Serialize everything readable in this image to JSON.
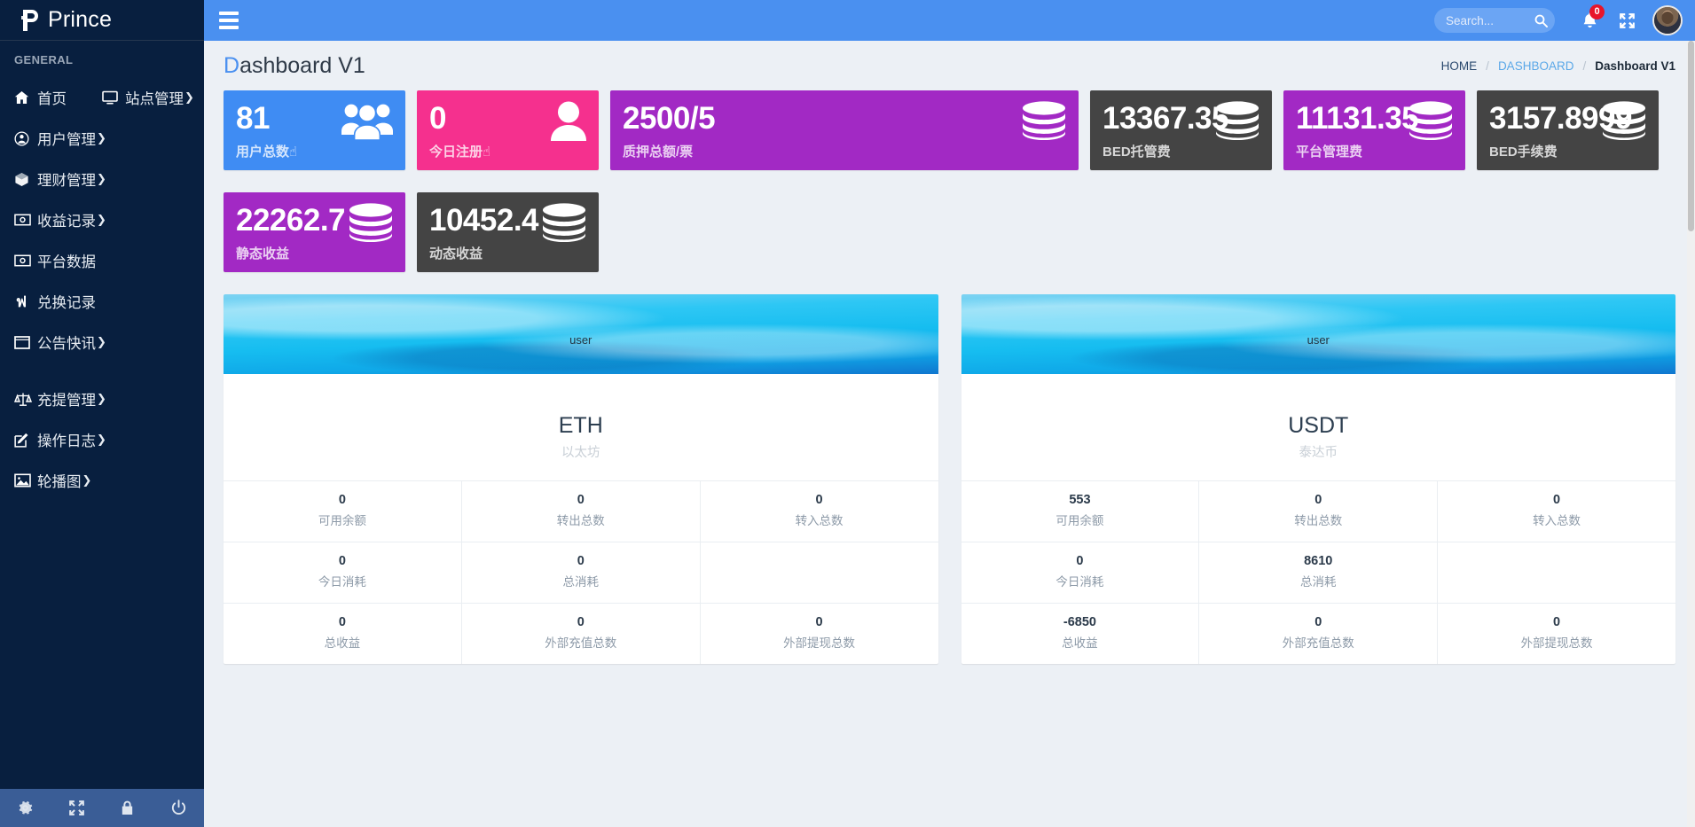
{
  "brand": {
    "name": "Prince",
    "logo_icon": "prince-p-logo"
  },
  "sidebar": {
    "section_header": "GENERAL",
    "items": [
      {
        "label": "首页",
        "icon": "home-icon",
        "caret": "",
        "active": true
      },
      {
        "label": "站点管理",
        "icon": "monitor-icon",
        "caret": "❯",
        "active": false
      },
      {
        "label": "用户管理",
        "icon": "user-circle-icon",
        "caret": "❯",
        "active": false
      },
      {
        "label": "理财管理",
        "icon": "cube-icon",
        "caret": "❯",
        "active": false
      },
      {
        "label": "收益记录",
        "icon": "money-bill-icon",
        "caret": "❯",
        "active": false
      },
      {
        "label": "平台数据",
        "icon": "money-bill-icon",
        "caret": "",
        "active": false
      },
      {
        "label": "兑换记录",
        "icon": "bitcoin-icon",
        "caret": "",
        "active": false
      },
      {
        "label": "公告快讯",
        "icon": "window-icon",
        "caret": "❯",
        "active": false
      },
      {
        "label": "充提管理",
        "icon": "balance-scale-icon",
        "caret": "❯",
        "active": false
      },
      {
        "label": "操作日志",
        "icon": "edit-pencil-icon",
        "caret": "❯",
        "active": false
      },
      {
        "label": "轮播图",
        "icon": "image-icon",
        "caret": "❯",
        "active": false
      }
    ],
    "footer_icons": [
      "gear-icon",
      "expand-arrows-icon",
      "lock-icon",
      "power-icon"
    ]
  },
  "header": {
    "hamburger_icon": "hamburger-menu-icon",
    "search": {
      "placeholder": "Search...",
      "value": "",
      "icon": "search-icon"
    },
    "notifications": {
      "icon": "bell-icon",
      "count": "0",
      "badge_color": "#e8152a"
    },
    "fullscreen_icon": "expand-arrows-icon",
    "avatar": {
      "icon": "avatar",
      "alt": "user-avatar"
    }
  },
  "page": {
    "title_first_letter": "D",
    "title_rest": "ashboard V1",
    "breadcrumb": [
      {
        "label": "HOME",
        "type": "link"
      },
      {
        "label": "DASHBOARD",
        "type": "link-active"
      },
      {
        "label": "Dashboard V1",
        "type": "current"
      }
    ],
    "separator": "/"
  },
  "stat_cards": [
    {
      "value": "81",
      "label": "用户总数☝",
      "color": "#3f8cf3",
      "icon": "users-group-icon",
      "size": "narrow"
    },
    {
      "value": "0",
      "label": "今日注册☝",
      "color": "#f5308e",
      "icon": "user-solid-icon",
      "size": "narrow"
    },
    {
      "value": "2500/5",
      "label": "质押总额/票",
      "color": "#a229c4",
      "icon": "database-icon",
      "size": "wide"
    },
    {
      "value": "13367.35",
      "label": "BED托管费",
      "color": "#444444",
      "icon": "database-icon",
      "size": "narrow"
    },
    {
      "value": "11131.35",
      "label": "平台管理费",
      "color": "#a229c4",
      "icon": "database-icon",
      "size": "narrow"
    },
    {
      "value": "3157.8999",
      "label": "BED手续费",
      "color": "#444444",
      "icon": "database-icon",
      "size": "narrow"
    },
    {
      "value": "22262.7",
      "label": "静态收益",
      "color": "#a229c4",
      "icon": "database-icon",
      "size": "narrow"
    },
    {
      "value": "10452.4",
      "label": "动态收益",
      "color": "#444444",
      "icon": "database-icon",
      "size": "narrow"
    }
  ],
  "coin_panels": [
    {
      "banner_tag": "user",
      "title": "ETH",
      "subtitle": "以太坊",
      "rows": [
        [
          {
            "value": "0",
            "label": "可用余额"
          },
          {
            "value": "0",
            "label": "转出总数"
          },
          {
            "value": "0",
            "label": "转入总数"
          }
        ],
        [
          {
            "value": "0",
            "label": "今日消耗"
          },
          {
            "value": "0",
            "label": "总消耗"
          },
          {
            "value": "",
            "label": ""
          }
        ],
        [
          {
            "value": "0",
            "label": "总收益"
          },
          {
            "value": "0",
            "label": "外部充值总数"
          },
          {
            "value": "0",
            "label": "外部提现总数"
          }
        ]
      ]
    },
    {
      "banner_tag": "user",
      "title": "USDT",
      "subtitle": "泰达币",
      "rows": [
        [
          {
            "value": "553",
            "label": "可用余额"
          },
          {
            "value": "0",
            "label": "转出总数"
          },
          {
            "value": "0",
            "label": "转入总数"
          }
        ],
        [
          {
            "value": "0",
            "label": "今日消耗"
          },
          {
            "value": "8610",
            "label": "总消耗"
          },
          {
            "value": "",
            "label": ""
          }
        ],
        [
          {
            "value": "-6850",
            "label": "总收益"
          },
          {
            "value": "0",
            "label": "外部充值总数"
          },
          {
            "value": "0",
            "label": "外部提现总数"
          }
        ]
      ]
    }
  ],
  "colors": {
    "sidebar_bg": "#081f3f",
    "header_bg": "#4a90f0",
    "content_bg": "#ecf0f5",
    "accent": "#4a90f0",
    "sidebar_footer_bg": "#3a5d96"
  }
}
